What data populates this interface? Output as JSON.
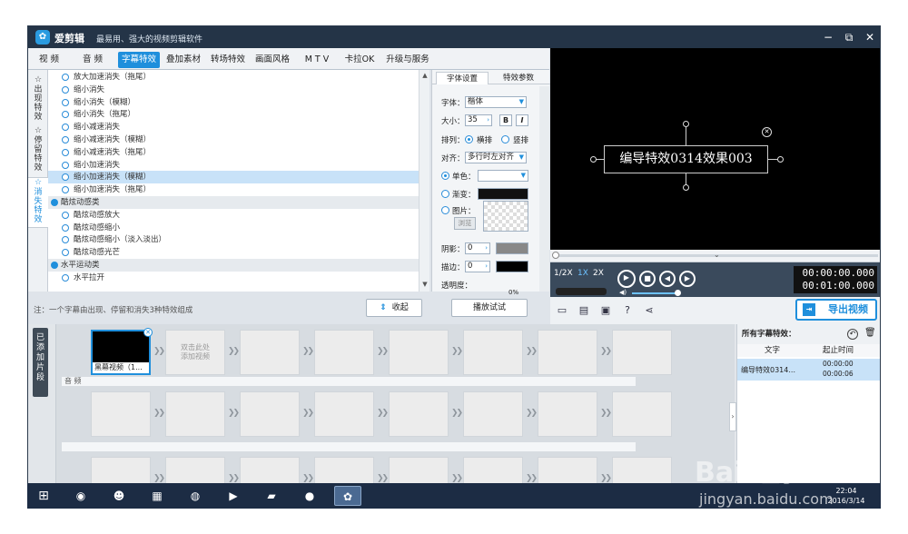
{
  "window": {
    "app_name": "爱剪辑",
    "slogan": "最易用、强大的视频剪辑软件",
    "minimize_glyph": "−",
    "restore_glyph": "⧉",
    "close_glyph": "✕"
  },
  "tabs": [
    "视 频",
    "音 频",
    "字幕特效",
    "叠加素材",
    "转场特效",
    "画面风格",
    "M T V",
    "卡拉OK",
    "升级与服务"
  ],
  "side_tabs": [
    {
      "label": "出现特效"
    },
    {
      "label": "停留特效"
    },
    {
      "label": "消失特效"
    }
  ],
  "effect_list": [
    {
      "kind": "item",
      "label": "放大加速消失（拖尾）"
    },
    {
      "kind": "item",
      "label": "缩小消失"
    },
    {
      "kind": "item",
      "label": "缩小消失（模糊）"
    },
    {
      "kind": "item",
      "label": "缩小消失（拖尾）"
    },
    {
      "kind": "item",
      "label": "缩小减速消失"
    },
    {
      "kind": "item",
      "label": "缩小减速消失（模糊）"
    },
    {
      "kind": "item",
      "label": "缩小减速消失（拖尾）"
    },
    {
      "kind": "item",
      "label": "缩小加速消失"
    },
    {
      "kind": "item",
      "label": "缩小加速消失（模糊）",
      "selected": true
    },
    {
      "kind": "item",
      "label": "缩小加速消失（拖尾）"
    },
    {
      "kind": "category",
      "label": "酷炫动感类"
    },
    {
      "kind": "item",
      "label": "酷炫动感放大"
    },
    {
      "kind": "item",
      "label": "酷炫动感缩小"
    },
    {
      "kind": "item",
      "label": "酷炫动感缩小（淡入淡出）"
    },
    {
      "kind": "item",
      "label": "酷炫动感光芒"
    },
    {
      "kind": "category",
      "label": "水平运动类"
    },
    {
      "kind": "item",
      "label": "水平拉开"
    }
  ],
  "footer": {
    "note": "注：一个字幕由出现、停留和消失3种特效组成",
    "collapse": "收起",
    "preview": "播放试试"
  },
  "settings": {
    "tab_font": "字体设置",
    "tab_effect": "特效参数",
    "font_label": "字体：",
    "font_value": "楷体",
    "size_label": "大小：",
    "size_value": "35",
    "bold": "B",
    "italic": "I",
    "layout_label": "排列：",
    "horizontal": "横排",
    "vertical": "竖排",
    "align_label": "对齐：",
    "align_value": "多行时左对齐",
    "solid_label": "单色：",
    "gradient_label": "渐变：",
    "image_label": "图片：",
    "browse": "浏览",
    "shadow_label": "阴影：",
    "shadow_value": "0",
    "stroke_label": "描边：",
    "stroke_value": "0",
    "opacity_label": "透明度：",
    "opacity_value": "0%",
    "colors": {
      "gradient": "#111111",
      "shadow": "#888888",
      "stroke": "#000000"
    }
  },
  "video": {
    "caption": "编导特效0314效果003"
  },
  "player": {
    "speeds": [
      "1/2X",
      "1X",
      "2X"
    ],
    "active_speed": "1X",
    "time_current": "00:00:00.000",
    "time_total": "00:01:00.000",
    "export": "导出视频",
    "volume_level": 0.9
  },
  "timeline": {
    "label": "已添加片段",
    "first_clip_caption": "黑幕视频（1...",
    "add_hint": "双击此处\n添加视频",
    "audio_label": "音 频"
  },
  "subtitle_panel": {
    "title": "所有字幕特效：",
    "col_text": "文字",
    "col_time": "起止时间",
    "entry_text": "编导特效0314...",
    "entry_start": "00:00:00",
    "entry_end": "00:00:06"
  },
  "taskbar": {
    "time": "22:04",
    "date": "2016/3/14"
  },
  "watermark": {
    "brand": "Bai 经验",
    "url": "jingyan.baidu.com"
  }
}
